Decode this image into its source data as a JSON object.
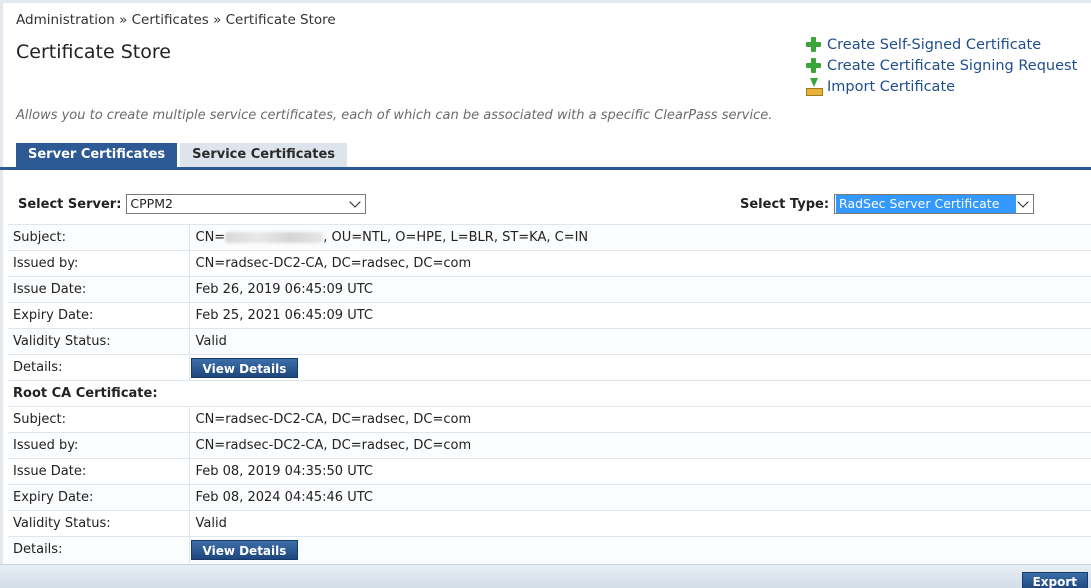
{
  "breadcrumb": "Administration » Certificates » Certificate Store",
  "page_title": "Certificate Store",
  "actions": [
    {
      "label": "Create Self-Signed Certificate",
      "icon": "plus-icon"
    },
    {
      "label": "Create Certificate Signing Request",
      "icon": "plus-icon"
    },
    {
      "label": "Import Certificate",
      "icon": "import-icon"
    }
  ],
  "description": "Allows you to create multiple service certificates, each of which can be associated with a specific ClearPass service.",
  "tabs": [
    {
      "label": "Server Certificates",
      "active": true
    },
    {
      "label": "Service Certificates",
      "active": false
    }
  ],
  "server_select": {
    "label": "Select Server:",
    "value": "CPPM2"
  },
  "type_select": {
    "label": "Select Type:",
    "value": "RadSec Server Certificate"
  },
  "server_cert": {
    "subject_label": "Subject:",
    "subject_prefix": "CN=",
    "subject_suffix": ", OU=NTL, O=HPE, L=BLR, ST=KA, C=IN",
    "issued_by_label": "Issued by:",
    "issued_by": "CN=radsec-DC2-CA, DC=radsec, DC=com",
    "issue_date_label": "Issue Date:",
    "issue_date": "Feb 26, 2019 06:45:09 UTC",
    "expiry_date_label": "Expiry Date:",
    "expiry_date": "Feb 25, 2021 06:45:09 UTC",
    "validity_label": "Validity Status:",
    "validity": "Valid",
    "details_label": "Details:",
    "details_button": "View Details"
  },
  "root_ca": {
    "heading": "Root CA Certificate:",
    "subject_label": "Subject:",
    "subject": "CN=radsec-DC2-CA, DC=radsec, DC=com",
    "issued_by_label": "Issued by:",
    "issued_by": "CN=radsec-DC2-CA, DC=radsec, DC=com",
    "issue_date_label": "Issue Date:",
    "issue_date": "Feb 08, 2019 04:35:50 UTC",
    "expiry_date_label": "Expiry Date:",
    "expiry_date": "Feb 08, 2024 04:45:46 UTC",
    "validity_label": "Validity Status:",
    "validity": "Valid",
    "details_label": "Details:",
    "details_button": "View Details"
  },
  "footer": {
    "export_label": "Export"
  }
}
